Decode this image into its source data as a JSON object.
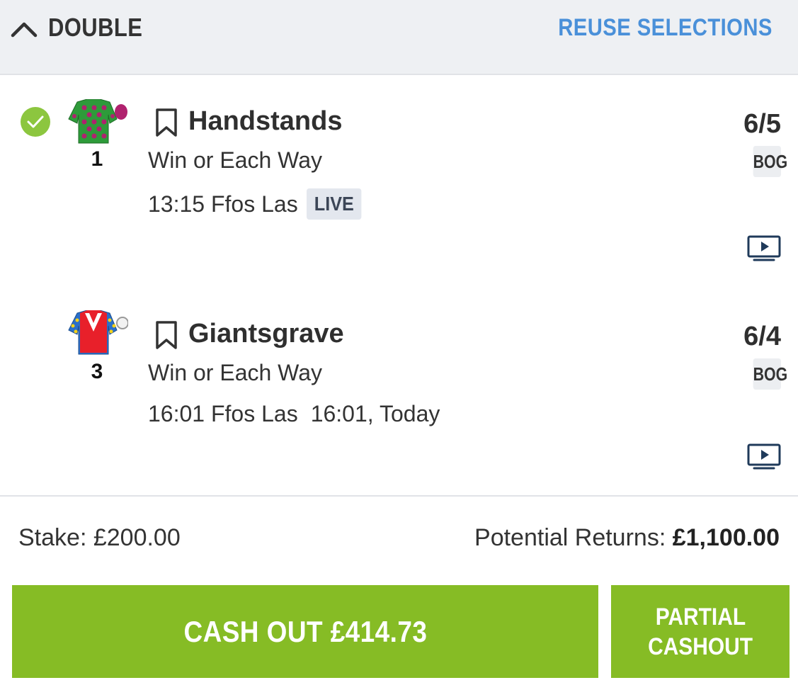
{
  "header": {
    "bet_type": "DOUBLE",
    "reuse_label": "REUSE SELECTIONS"
  },
  "selections": [
    {
      "number": "1",
      "name": "Handstands",
      "market": "Win or Each Way",
      "race": "13:15 Ffos Las",
      "live_badge": "LIVE",
      "extra": "",
      "odds": "6/5",
      "bog": "BOG",
      "settled": true
    },
    {
      "number": "3",
      "name": "Giantsgrave",
      "market": "Win or Each Way",
      "race": "16:01 Ffos Las",
      "live_badge": "",
      "extra": "16:01, Today",
      "odds": "6/4",
      "bog": "BOG",
      "settled": false
    }
  ],
  "summary": {
    "stake_label": "Stake:",
    "stake_value": "£200.00",
    "returns_label": "Potential Returns:",
    "returns_value": "£1,100.00"
  },
  "actions": {
    "cashout_label": "CASH OUT £414.73",
    "partial_line1": "PARTIAL",
    "partial_line2": "CASHOUT"
  },
  "colors": {
    "accent_green": "#86bc25",
    "link_blue": "#4a90d9",
    "check_green": "#8cc63f"
  }
}
